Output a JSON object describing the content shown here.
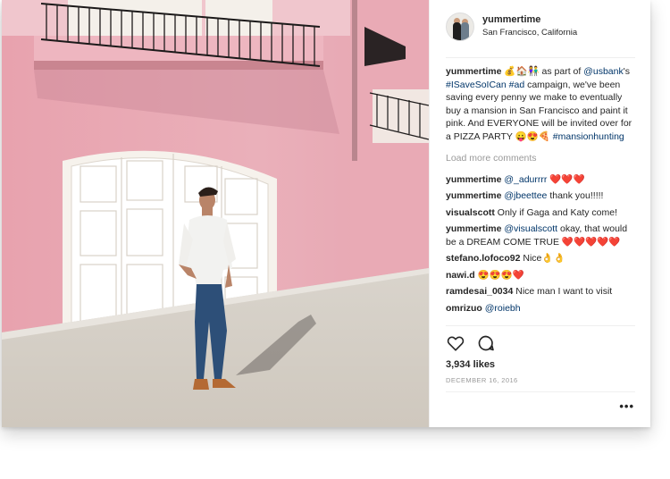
{
  "header": {
    "username": "yummertime",
    "location": "San Francisco, California"
  },
  "caption": {
    "username": "yummertime",
    "emoji": "💰🏠👫",
    "text_1": " as part of ",
    "mention": "@usbank",
    "text_2": "'s",
    "hashtag_1": "#ISaveSoICan",
    "hashtag_2": "#ad",
    "text_3": " campaign, we've been saving every penny we make to eventually buy a mansion in San Francisco and paint it pink. And EVERYONE will be invited over for a PIZZA PARTY ",
    "emoji_end": "😛😍🍕",
    "hashtag_3": "#mansionhunting"
  },
  "load_more": "Load more comments",
  "comments": [
    {
      "user": "yummertime",
      "mention": "@_adurrrr",
      "text": " ❤️❤️❤️"
    },
    {
      "user": "yummertime",
      "mention": "@jbeettee",
      "text": " thank you!!!!!"
    },
    {
      "user": "visualscott",
      "mention": "",
      "text": "Only if Gaga and Katy come!"
    },
    {
      "user": "yummertime",
      "mention": "@visualscott",
      "text": " okay, that would be a DREAM COME TRUE ❤️❤️❤️❤️❤️"
    },
    {
      "user": "stefano.lofoco92",
      "mention": "",
      "text": "Nice👌👌"
    },
    {
      "user": "nawi.d",
      "mention": "",
      "text": "😍😍😍❤️"
    },
    {
      "user": "ramdesai_0034",
      "mention": "",
      "text": "Nice man I want to visit"
    },
    {
      "user": "omrizuo",
      "mention": "@roiebh",
      "text": ""
    }
  ],
  "actions": {
    "like_icon": "heart-outline-icon",
    "comment_icon": "speech-bubble-icon"
  },
  "likes": "3,934 likes",
  "date": "DECEMBER 16, 2016",
  "more_label": "•••",
  "colors": {
    "link": "#003569",
    "muted": "#999999",
    "text": "#262626",
    "wall_pink": "#e9a8b4"
  }
}
